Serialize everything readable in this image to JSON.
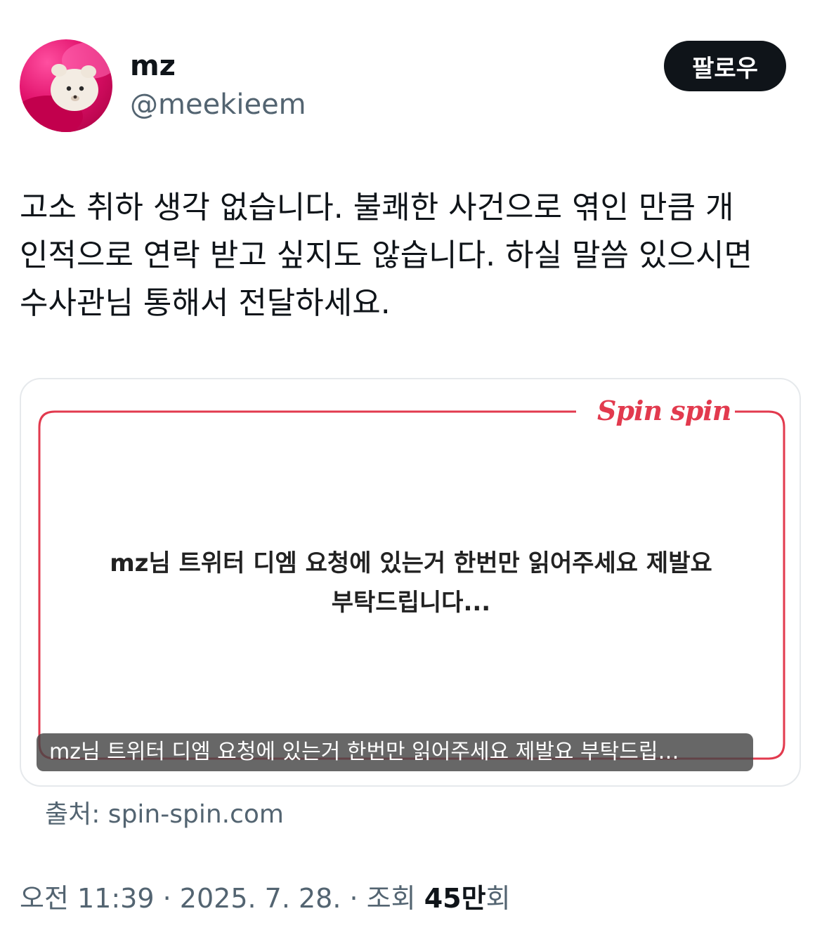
{
  "user": {
    "display_name": "mz",
    "handle": "@meekieem",
    "avatar_icon": "plush-toy-avatar-icon"
  },
  "follow_button": {
    "label": "팔로우"
  },
  "tweet": {
    "lines": [
      "고소 취하 생각 없습니다. 불쾌한 사건으로 엮인 만큼 개",
      "인적으로 연락 받고 싶지도 않습니다. 하실 말씀 있으시면",
      "수사관님 통해서 전달하세요."
    ]
  },
  "media": {
    "brand": "Spin spin",
    "accent_color": "#e23a4e",
    "message_lines": [
      "mz님 트위터 디엠 요청에 있는거 한번만 읽어주세요 제발요",
      "부탁드립니다..."
    ],
    "caption": "mz님 트위터 디엠 요청에 있는거 한번만 읽어주세요 제발요 부탁드립…"
  },
  "source": {
    "label": "출처: spin-spin.com"
  },
  "meta": {
    "time": "오전 11:39",
    "separator": "·",
    "date": "2025. 7. 28.",
    "views_label": "조회",
    "views_count": "45만",
    "views_unit": "회"
  }
}
